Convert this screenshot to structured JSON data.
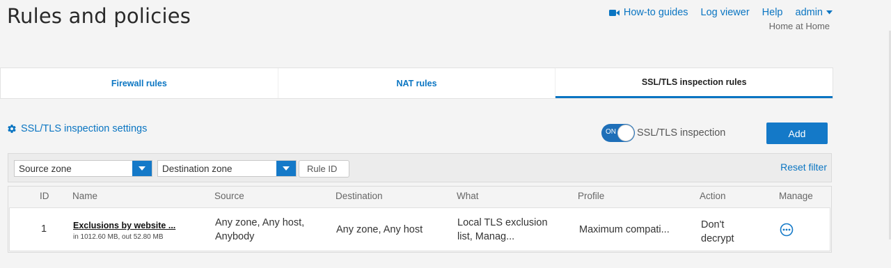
{
  "page": {
    "title": "Rules and policies"
  },
  "topnav": {
    "howto": "How-to guides",
    "logviewer": "Log viewer",
    "help": "Help",
    "admin": "admin",
    "location": "Home at Home"
  },
  "tabs": [
    {
      "label": "Firewall rules",
      "active": false
    },
    {
      "label": "NAT rules",
      "active": false
    },
    {
      "label": "SSL/TLS inspection rules",
      "active": true
    }
  ],
  "settings_link": "SSL/TLS inspection settings",
  "toggle": {
    "state": "ON",
    "label": "SSL/TLS inspection"
  },
  "add_button": "Add",
  "filters": {
    "source_zone": "Source zone",
    "destination_zone": "Destination zone",
    "rule_id_placeholder": "Rule ID",
    "reset": "Reset filter"
  },
  "table": {
    "headers": [
      "ID",
      "Name",
      "Source",
      "Destination",
      "What",
      "Profile",
      "Action",
      "Manage"
    ],
    "rows": [
      {
        "id": "1",
        "name": "Exclusions by website ...",
        "traffic": "in 1012.60 MB, out 52.80 MB",
        "source_line1": "Any zone, Any host,",
        "source_line2": "Anybody",
        "destination": "Any zone, Any host",
        "what_line1": "Local TLS exclusion",
        "what_line2": "list, Manag...",
        "profile": "Maximum compati...",
        "action_line1": "Don't",
        "action_line2": "decrypt"
      }
    ]
  },
  "colors": {
    "accent": "#1479c8",
    "link": "#0a75c2",
    "background": "#f4f4f4"
  }
}
